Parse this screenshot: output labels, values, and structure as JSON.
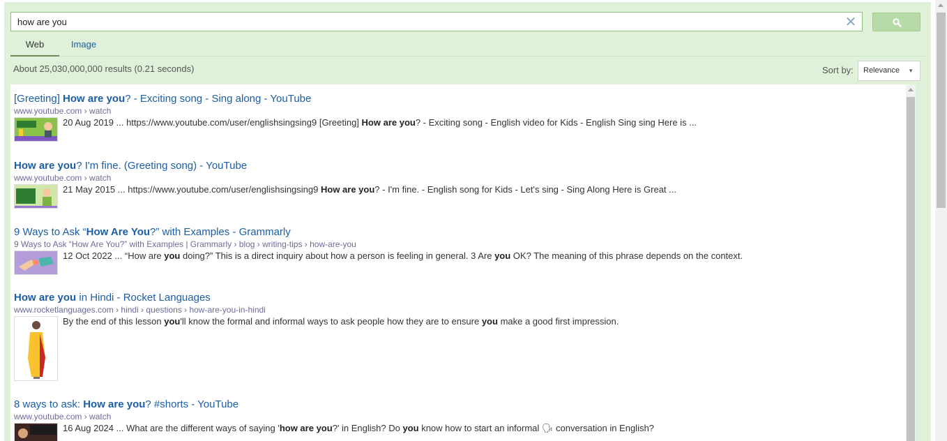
{
  "search": {
    "query": "how are you",
    "clear_glyph": "✕",
    "button_icon": "search-icon"
  },
  "tabs": [
    {
      "label": "Web",
      "active": true
    },
    {
      "label": "Image",
      "active": false
    }
  ],
  "stats": "About 25,030,000,000 results (0.21 seconds)",
  "sort": {
    "label": "Sort by:",
    "value": "Relevance"
  },
  "colors": {
    "panel": "#e0f1d9",
    "link": "#1a5ea8",
    "url": "#6b6b9a",
    "button": "#b6dba6"
  },
  "results": [
    {
      "title_parts": [
        {
          "t": "[Greeting] ",
          "b": false
        },
        {
          "t": "How are you",
          "b": true
        },
        {
          "t": "? - Exciting song - Sing along - YouTube",
          "b": false
        }
      ],
      "url": "www.youtube.com › watch",
      "thumbnail": "video-thumbnail-greeting-song",
      "snippet_parts": [
        {
          "t": "20 Aug 2019 ... https://www.youtube.com/user/englishsingsing9 [Greeting] ",
          "b": false
        },
        {
          "t": "How are you",
          "b": true
        },
        {
          "t": "? - Exciting song - English video for Kids - English Sing sing Here is ...",
          "b": false
        }
      ]
    },
    {
      "title_parts": [
        {
          "t": "How are you",
          "b": true
        },
        {
          "t": "? I'm fine. (Greeting song) - YouTube",
          "b": false
        }
      ],
      "url": "www.youtube.com › watch",
      "thumbnail": "video-thumbnail-im-fine",
      "snippet_parts": [
        {
          "t": "21 May 2015 ... https://www.youtube.com/user/englishsingsing9 ",
          "b": false
        },
        {
          "t": "How are you",
          "b": true
        },
        {
          "t": "? - I'm fine. - English song for Kids - Let's sing - Sing Along Here is Great ...",
          "b": false
        }
      ]
    },
    {
      "title_parts": [
        {
          "t": "9 Ways to Ask “",
          "b": false
        },
        {
          "t": "How Are You",
          "b": true
        },
        {
          "t": "?” with Examples - Grammarly",
          "b": false
        }
      ],
      "url": "9 Ways to Ask “How Are You?” with Examples | Grammarly › blog › writing-tips › how-are-you",
      "thumbnail": "grammarly-illustration",
      "snippet_parts": [
        {
          "t": "12 Oct 2022 ... “How are ",
          "b": false
        },
        {
          "t": "you",
          "b": true
        },
        {
          "t": " doing?” This is a direct inquiry about how a person is feeling in general. 3 Are ",
          "b": false
        },
        {
          "t": "you",
          "b": true
        },
        {
          "t": " OK? The meaning of this phrase depends on the context.",
          "b": false
        }
      ]
    },
    {
      "title_parts": [
        {
          "t": "How are you",
          "b": true
        },
        {
          "t": " in Hindi - Rocket Languages",
          "b": false
        }
      ],
      "url": "www.rocketlanguages.com › hindi › questions › how-are-you-in-hindi",
      "thumbnail": "woman-in-saree-photo",
      "snippet_parts": [
        {
          "t": "By the end of this lesson ",
          "b": false
        },
        {
          "t": "you",
          "b": true
        },
        {
          "t": "'ll know the formal and informal ways to ask people how they are to ensure ",
          "b": false
        },
        {
          "t": "you",
          "b": true
        },
        {
          "t": " make a good first impression.",
          "b": false
        }
      ]
    },
    {
      "title_parts": [
        {
          "t": "8 ways to ask: ",
          "b": false
        },
        {
          "t": "How are you",
          "b": true
        },
        {
          "t": "? #shorts - YouTube",
          "b": false
        }
      ],
      "url": "www.youtube.com › watch",
      "thumbnail": "video-thumbnail-shorts",
      "snippet_parts": [
        {
          "t": "16 Aug 2024 ... What are the different ways of saying '",
          "b": false
        },
        {
          "t": "how are you",
          "b": true
        },
        {
          "t": "?' in English? Do ",
          "b": false
        },
        {
          "t": "you",
          "b": true
        },
        {
          "t": " know how to start an informal 🗣 conversation in English?",
          "b": false
        }
      ]
    }
  ]
}
